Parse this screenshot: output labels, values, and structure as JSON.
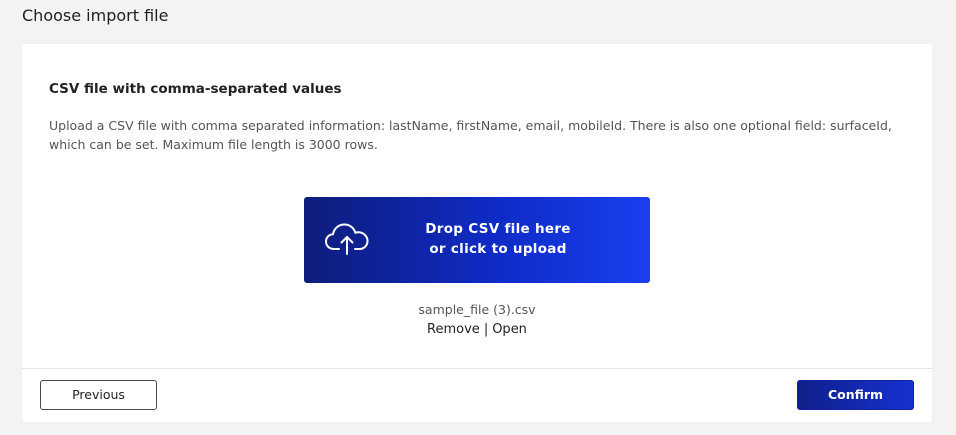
{
  "page": {
    "title": "Choose import file"
  },
  "section": {
    "heading": "CSV file with comma-separated values",
    "description": "Upload a CSV file with comma separated information: lastName, firstName, email, mobileId. There is also one optional field: surfaceId, which can be set. Maximum file length is 3000 rows."
  },
  "dropzone": {
    "line1": "Drop CSV file here",
    "line2": "or click to upload",
    "icon": "cloud-upload-icon"
  },
  "file": {
    "name": "sample_file (3).csv",
    "remove_label": "Remove",
    "separator": "|",
    "open_label": "Open"
  },
  "footer": {
    "previous_label": "Previous",
    "confirm_label": "Confirm"
  },
  "colors": {
    "accent": "#1532d0",
    "accent_dark": "#0e1d7a",
    "background": "#f3f3f4",
    "card": "#ffffff"
  }
}
